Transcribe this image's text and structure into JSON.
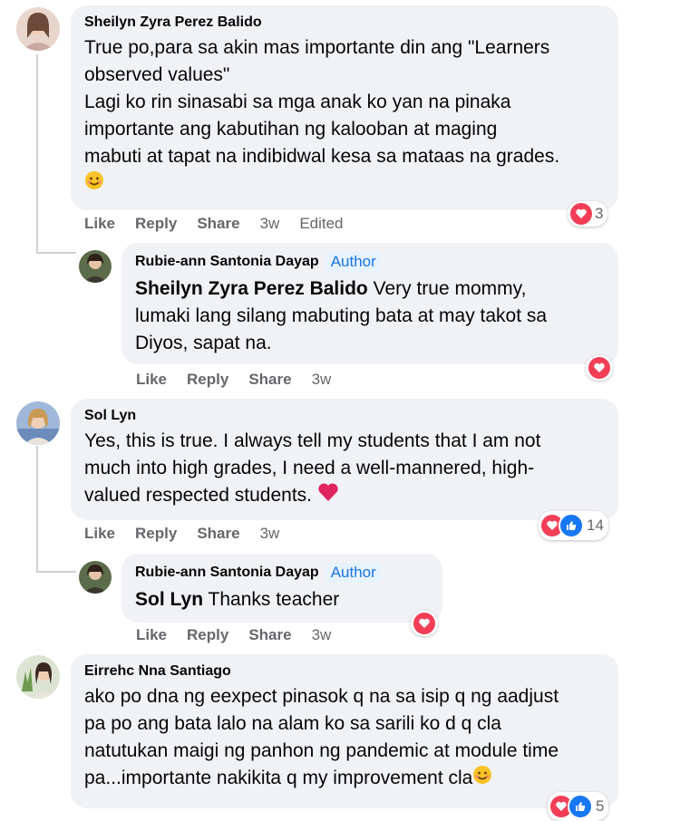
{
  "comments": [
    {
      "author": "Sheilyn Zyra Perez Balido",
      "text_lines": [
        "True po,para sa akin mas importante din ang \"Learners",
        "observed values\"",
        "Lagi ko rin sinasabi sa mga anak ko yan na pinaka",
        "importante ang kabutihan ng kalooban at maging",
        "mabuti at tapat na indibidwal kesa sa mataas na grades."
      ],
      "emoji": "smile-emoji",
      "actions": {
        "like": "Like",
        "reply": "Reply",
        "share": "Share",
        "time": "3w",
        "edited": "Edited"
      },
      "reaction_count": "3"
    },
    {
      "author": "Rubie-ann Santonia Dayap",
      "badge": "Author",
      "mention": "Sheilyn Zyra Perez Balido",
      "text_lines": [
        " Very true mommy,",
        "lumaki lang silang mabuting bata at may takot sa",
        "Diyos, sapat na."
      ],
      "actions": {
        "like": "Like",
        "reply": "Reply",
        "share": "Share",
        "time": "3w"
      }
    },
    {
      "author": "Sol Lyn",
      "text_lines": [
        "Yes, this is true. I always tell my students that I am not",
        "much into high grades, I need a well-mannered, high-",
        "valued respected students."
      ],
      "emoji": "red-heart-emoji",
      "actions": {
        "like": "Like",
        "reply": "Reply",
        "share": "Share",
        "time": "3w"
      },
      "reaction_count": "14"
    },
    {
      "author": "Rubie-ann Santonia Dayap",
      "badge": "Author",
      "mention": "Sol Lyn",
      "text_after_mention": " Thanks teacher",
      "actions": {
        "like": "Like",
        "reply": "Reply",
        "share": "Share",
        "time": "3w"
      }
    },
    {
      "author": "Eirrehc Nna Santiago",
      "text_lines": [
        "ako po dna ng eexpect pinasok q na sa isip q ng aadjust",
        "pa po ang bata lalo na alam ko sa sarili ko d q cla",
        "natutukan maigi ng panhon ng pandemic at module time",
        "pa...importante nakikita q my improvement cla"
      ],
      "emoji": "smile-emoji",
      "reaction_count": "5"
    }
  ],
  "colors": {
    "bubble": "#f0f2f5",
    "love": "#f33e58",
    "like": "#1877f2",
    "author_badge_bg": "#e7f3ff",
    "author_badge_text": "#1b74e4"
  }
}
